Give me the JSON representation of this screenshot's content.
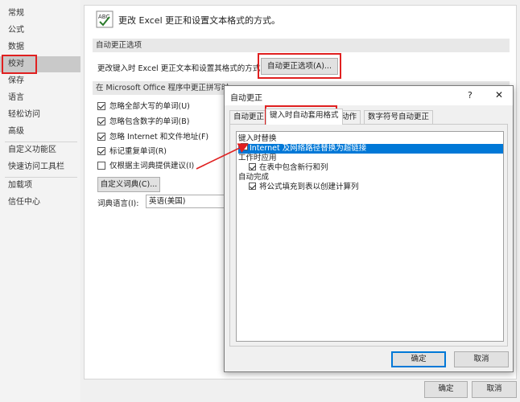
{
  "sidebar": {
    "items": [
      {
        "label": "常规"
      },
      {
        "label": "公式"
      },
      {
        "label": "数据"
      },
      {
        "label": "校对"
      },
      {
        "label": "保存"
      },
      {
        "label": "语言"
      },
      {
        "label": "轻松访问"
      },
      {
        "label": "高级"
      },
      {
        "label": "自定义功能区"
      },
      {
        "label": "快速访问工具栏"
      },
      {
        "label": "加载项"
      },
      {
        "label": "信任中心"
      }
    ],
    "selected": "校对"
  },
  "main": {
    "header_text": "更改 Excel 更正和设置文本格式的方式。",
    "autocorrect_section": {
      "title": "自动更正选项",
      "description": "更改键入时 Excel 更正文本和设置其格式的方式:",
      "button_label": "自动更正选项(A)..."
    },
    "spelling_section": {
      "title": "在 Microsoft Office 程序中更正拼写时",
      "options": [
        {
          "label": "忽略全部大写的单词(U)",
          "checked": true
        },
        {
          "label": "忽略包含数字的单词(B)",
          "checked": true
        },
        {
          "label": "忽略 Internet 和文件地址(F)",
          "checked": true
        },
        {
          "label": "标记重复单词(R)",
          "checked": true
        },
        {
          "label": "仅根据主词典提供建议(I)",
          "checked": false
        }
      ],
      "custom_dict_button": "自定义词典(C)...",
      "dict_lang_label": "词典语言(I):",
      "dict_lang_value": "英语(美国)"
    }
  },
  "dialog": {
    "title": "自动更正",
    "help": "?",
    "close": "✕",
    "tabs": [
      {
        "label": "自动更正"
      },
      {
        "label": "键入时自动套用格式"
      },
      {
        "label": "动作"
      },
      {
        "label": "数字符号自动更正"
      }
    ],
    "active_tab": "键入时自动套用格式",
    "groups": {
      "replace_title": "键入时替换",
      "hyperlink_option": "Internet 及网络路径替换为超链接",
      "apply_title": "工作时应用",
      "table_option": "在表中包含新行和列",
      "complete_title": "自动完成",
      "formula_option": "将公式填充到表以创建计算列"
    },
    "ok_label": "确定",
    "cancel_label": "取消"
  },
  "footer": {
    "ok_label": "确定",
    "cancel_label": "取消"
  },
  "colors": {
    "highlight": "#0078d7",
    "annotation": "#e02020"
  }
}
